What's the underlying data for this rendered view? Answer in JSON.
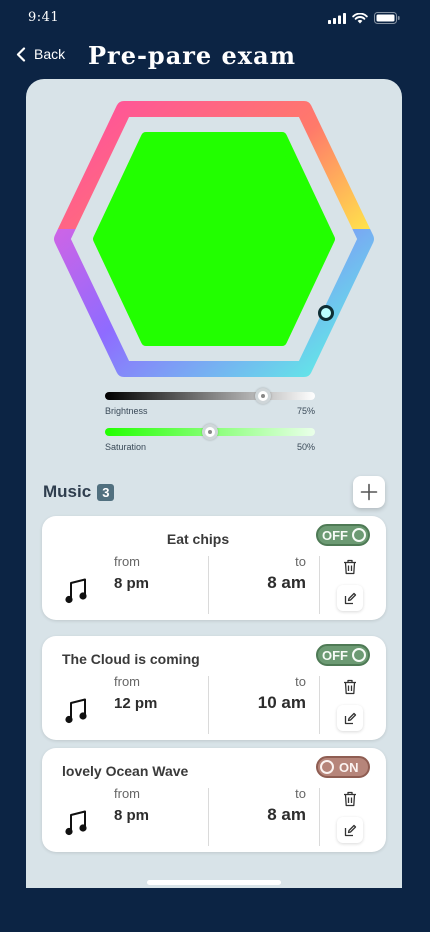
{
  "status": {
    "time": "9:41"
  },
  "nav": {
    "back_label": "Back",
    "title": "Pre-pare exam"
  },
  "color_picker": {
    "selected_color": "#22ff00",
    "brightness": {
      "label": "Brightness",
      "value": "75%",
      "level": 0.75
    },
    "saturation": {
      "label": "Saturation",
      "value": "50%",
      "level": 0.5
    }
  },
  "music": {
    "title": "Music",
    "count": "3",
    "items": [
      {
        "title": "Eat chips",
        "from_label": "from",
        "from": "8 pm",
        "to_label": "to",
        "to": "8 am",
        "toggle": "OFF"
      },
      {
        "title": "The Cloud is coming",
        "from_label": "from",
        "from": "12 pm",
        "to_label": "to",
        "to": "10 am",
        "toggle": "OFF"
      },
      {
        "title": "lovely Ocean Wave",
        "from_label": "from",
        "from": "8 pm",
        "to_label": "to",
        "to": "8 am",
        "toggle": "ON"
      }
    ]
  },
  "colors": {
    "background": "#0c2444",
    "panel": "#d8e3e8",
    "toggle_off": "#6c9a73",
    "toggle_on": "#b6857a"
  },
  "icons": [
    "back-chevron-icon",
    "signal-icon",
    "wifi-icon",
    "battery-icon",
    "plus-icon",
    "music-note-icon",
    "trash-icon",
    "edit-icon"
  ]
}
